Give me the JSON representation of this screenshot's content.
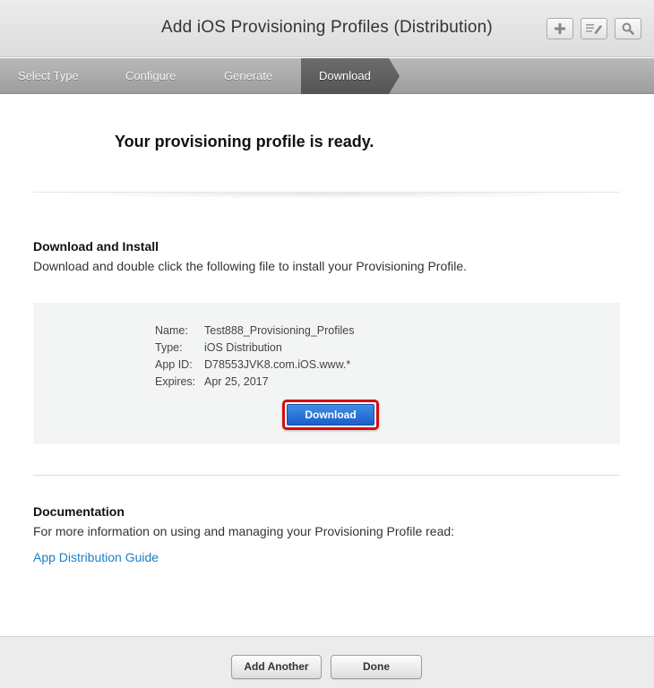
{
  "header": {
    "title": "Add iOS Provisioning Profiles (Distribution)",
    "tools": [
      "plus-icon",
      "edit-icon",
      "search-icon"
    ]
  },
  "steps": {
    "items": [
      "Select Type",
      "Configure",
      "Generate",
      "Download"
    ],
    "active": "Download"
  },
  "main": {
    "ready_title": "Your provisioning profile is ready.",
    "download_section": {
      "heading": "Download and Install",
      "text": "Download and double click the following file to install your Provisioning Profile."
    },
    "profile": {
      "name_label": "Name:",
      "name_value": "Test888_Provisioning_Profiles",
      "type_label": "Type:",
      "type_value": "iOS Distribution",
      "appid_label": "App ID:",
      "appid_value": "D78553JVK8.com.iOS.www.*",
      "expires_label": "Expires:",
      "expires_value": "Apr 25, 2017",
      "download_label": "Download"
    },
    "documentation": {
      "heading": "Documentation",
      "text": "For more information on using and managing your Provisioning Profile read:",
      "link": "App Distribution Guide"
    }
  },
  "footer": {
    "add_another_label": "Add Another",
    "done_label": "Done"
  },
  "colors": {
    "link": "#1a7fc4",
    "primary_button": "#1b5fc9",
    "highlight_border": "#d40d12",
    "active_step": "#606060"
  }
}
